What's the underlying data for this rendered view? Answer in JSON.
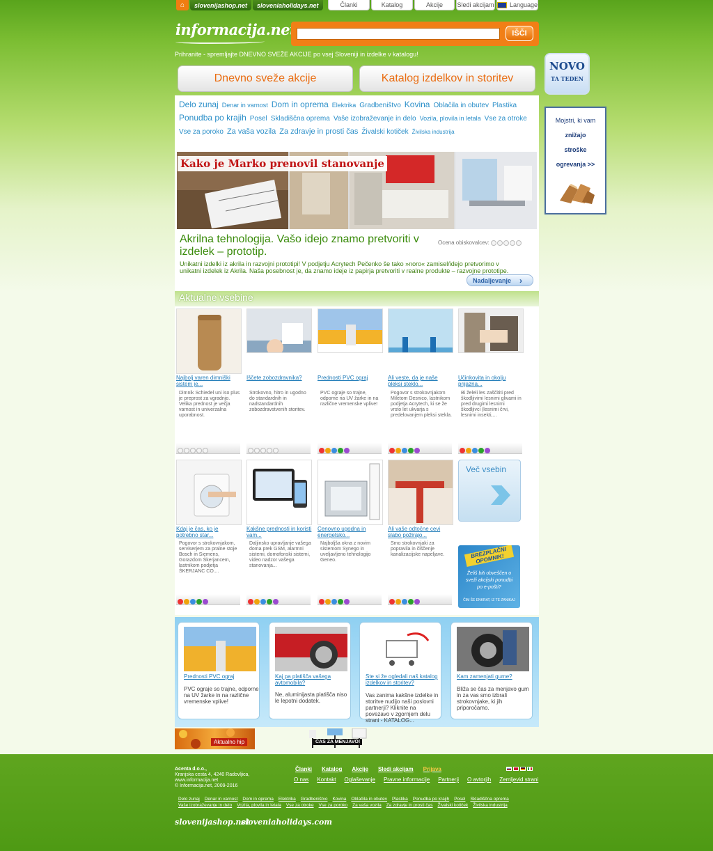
{
  "topbar": {
    "site1": "slovenijashop.net",
    "site2": "sloveniaholidays.net",
    "nav": [
      "Članki",
      "Katalog",
      "Akcije",
      "Sledi akcijam"
    ],
    "language": "Language"
  },
  "header": {
    "logo": "informacija.net",
    "search_placeholder": "",
    "search_button": "IŠČI",
    "tagline": "Prihranite - spremljajte DNEVNO SVEŽE AKCIJE po vsej Sloveniji in izdelke v katalogu!"
  },
  "bigbuttons": [
    "Dnevno sveže akcije",
    "Katalog izdelkov in storitev"
  ],
  "novo": {
    "line1": "NOVO",
    "line2": "TA TEDEN"
  },
  "side_ad": {
    "l1": "Mojstri, ki vam",
    "l2": "znižajo",
    "l3": "stroške",
    "l4": "ogrevanja >>"
  },
  "categories": [
    {
      "label": "Delo zunaj",
      "size": 12
    },
    {
      "label": "Denar in varnost",
      "size": 9
    },
    {
      "label": "Dom in oprema",
      "size": 12
    },
    {
      "label": "Elektrika",
      "size": 9
    },
    {
      "label": "Gradbeništvo",
      "size": 10
    },
    {
      "label": "Kovina",
      "size": 12
    },
    {
      "label": "Oblačila in obutev",
      "size": 10
    },
    {
      "label": "Plastika",
      "size": 10
    },
    {
      "label": "Ponudba po krajih",
      "size": 12
    },
    {
      "label": "Posel",
      "size": 10
    },
    {
      "label": "Skladiščna oprema",
      "size": 10
    },
    {
      "label": "Vaše izobraževanje in delo",
      "size": 10
    },
    {
      "label": "Vozila, plovila in letala",
      "size": 9
    },
    {
      "label": "Vse za otroke",
      "size": 10
    },
    {
      "label": "Vse za poroko",
      "size": 10
    },
    {
      "label": "Za vaša vozila",
      "size": 11
    },
    {
      "label": "Za zdravje in prosti čas",
      "size": 11
    },
    {
      "label": "Živalski kotiček",
      "size": 10
    },
    {
      "label": "Živilska industrija",
      "size": 8
    }
  ],
  "banner": {
    "title": "Kako je Marko prenovil stanovanje"
  },
  "feature": {
    "headline": "Akrilna tehnologija. Vašo idejo znamo pretvoriti v izdelek – prototip.",
    "rating_label": "Ocena obiskovalcev:",
    "excerpt": "Unikatni izdelki iz akrila in razvojni prototipi! V podjetju Acrytech Pečenko še tako »noro« zamisel/idejo pretvorimo v unikatni izdelek iz Akrila. Naša posebnost je, da znamo ideje iz papirja pretvoriti v realne produkte – razvojne prototipe.",
    "more": "Nadaljevanje"
  },
  "section_title": "Aktualne vsebine",
  "cards_row1": [
    {
      "title": "Najbolj varen dimniški sistem je...",
      "text": "Dimnik Schiedel uni iso plus je preprost za vgradnjo. Velika prednost je večja varnost in univerzalna uporabnost.",
      "rating": 0
    },
    {
      "title": "Iščete zobozdravnika?",
      "text": "Strokovno, hitro in ugodno do standardnih in nadstandardnih zobozdravstvenih storitev.",
      "rating": 0
    },
    {
      "title": "Prednosti PVC ograj",
      "text": "PVC ograje so trajne, odporne na UV žarke in na različne vremenske vplive!",
      "rating": 5
    },
    {
      "title": "Ali veste, da je naše pleksi steklo...",
      "text": "Pogovor s strokovnjakom Miletom Desnico, lastnikom podjetja Acrytech, ki se že vrsto let ukvarja s predelovanjem pleksi stekla.",
      "rating": 5
    },
    {
      "title": "Učinkovita in okolju prijazna...",
      "text": "Bi želeli les zaščititi pred škodljivimi lesnimi glivami in pred drugimi lesnimi škodljivci (lesnimi črvi, lesnimi insekti,...",
      "rating": 5
    }
  ],
  "cards_row2": [
    {
      "title": "Kdaj je čas, ko je potrebno star...",
      "text": "Pogovor s strokovnjakom, serviserjem za pralne stoje Bosch in Siemens, Gorazdom Škerjancem, lastnikom podjetja ŠKERJANC CO....",
      "rating": 5
    },
    {
      "title": "Kakšne prednosti in koristi vam...",
      "text": "Daljinsko upravljanje vašega doma prek GSM, alarmni sistemi, domofonski sistemi, video nadzor vašega stanovanja...",
      "rating": 5
    },
    {
      "title": "Cenovno ugodna in energetsko...",
      "text": "Najboljša okna z novim sistemom Synego in uveljavljeno tehnologijo Geneo.",
      "rating": 5
    },
    {
      "title": "Ali vaše odtočne cevi slabo požirajo...",
      "text": "Smo strokovnjaki za popravila in čiščenje kanalizacijske napeljave.",
      "rating": 5
    }
  ],
  "more_box": "Več vsebin",
  "promo": {
    "tag": "BREZPLAČNI OPOMNIK!",
    "text": "Želiš biti obveščen o sveži akcijski ponudbi po e-pošti?",
    "small": "ČIM ŠE ENKRAT, IZ TE ZANIKAJ"
  },
  "blue_cards": [
    {
      "title": "Prednosti PVC ograj",
      "text": "PVC ograje so trajne, odporne na UV žarke in na različne vremenske vplive!"
    },
    {
      "title": "Kaj pa platišča vašega avtomobila?",
      "text": "Ne, aluminijasta platišča niso le lepotni dodatek."
    },
    {
      "title": "Ste si že ogledali naš katalog izdelkov in storitev?",
      "text": "Vas zanima kakšne izdelke in storitve nudijo naši poslovni partnerji? Kliknite na povezavo v zgornjem delu strani - KATALOG..."
    },
    {
      "title": "Kam zamenjati gume?",
      "text": "Bliža se čas za menjavo gum in za vas smo izbrali strokovnjake, ki jih priporočamo."
    }
  ],
  "hip": "Aktualno hip",
  "cas": "ČAS ZA MENJAVO!",
  "footer": {
    "addr": [
      "Acenta d.o.o.,",
      "Kranjska cesta 4, 4240 Radovljica,",
      "www.informacija.net",
      "© Informacija.net, 2009-2016"
    ],
    "links1": [
      "Članki",
      "Katalog",
      "Akcije",
      "Sledi akcijam",
      "Prijava"
    ],
    "links2": [
      "O nas",
      "Kontakt",
      "Oglaševanje",
      "Pravne informacije",
      "Partnerji",
      "O avtorjih",
      "Zemljevid strani"
    ],
    "cats": [
      "Delo zunaj",
      "Denar in varnost",
      "Dom in oprema",
      "Elektrika",
      "Gradbeništvo",
      "Kovina",
      "Oblačila in obutev",
      "Plastika",
      "Ponudba po krajih",
      "Posel",
      "Skladiščna oprema",
      "Vaše izobraževanje in delo",
      "Vozila, plovila in letala",
      "Vse za otroke",
      "Vse za poroko",
      "Za vaša vozila",
      "Za zdravje in prosti čas",
      "Živalski kotiček",
      "Živilska industrija"
    ],
    "logo1": "slovenijashop.net",
    "logo2": "sloveniaholidays.com"
  },
  "colors": {
    "brand_green": "#6bb32a",
    "accent_orange": "#ea6d12",
    "link_blue": "#1f7bb8"
  }
}
